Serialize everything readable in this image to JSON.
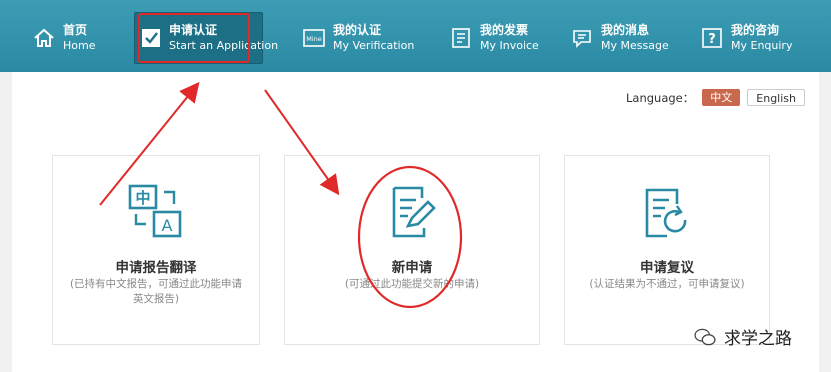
{
  "nav": {
    "items": [
      {
        "zh": "首页",
        "en": "Home",
        "icon": "home-icon"
      },
      {
        "zh": "申请认证",
        "en": "Start an Application",
        "icon": "checkbox-icon",
        "active": true
      },
      {
        "zh": "我的认证",
        "en": "My Verification",
        "icon": "mine-card-icon",
        "badge": "Mine"
      },
      {
        "zh": "我的发票",
        "en": "My Invoice",
        "icon": "invoice-icon"
      },
      {
        "zh": "我的消息",
        "en": "My Message",
        "icon": "message-icon"
      },
      {
        "zh": "我的咨询",
        "en": "My Enquiry",
        "icon": "enquiry-icon",
        "badge": "?"
      }
    ]
  },
  "language": {
    "label": "Language：",
    "zh": "中文",
    "en": "English"
  },
  "cards": [
    {
      "title": "申请报告翻译",
      "desc": "(已持有中文报告，可通过此功能申请英文报告)",
      "icon": "translate-icon"
    },
    {
      "title": "新申请",
      "desc": "(可通过此功能提交新的申请)",
      "icon": "edit-document-icon"
    },
    {
      "title": "申请复议",
      "desc": "(认证结果为不通过，可申请复议)",
      "icon": "review-document-icon"
    }
  ],
  "watermark": {
    "text": "求学之路",
    "icon": "wechat-icon"
  },
  "colors": {
    "nav": "#2f93ac",
    "accent": "#2a8aa3",
    "annotation": "#e02a2a",
    "lang_active": "#c8694e"
  }
}
